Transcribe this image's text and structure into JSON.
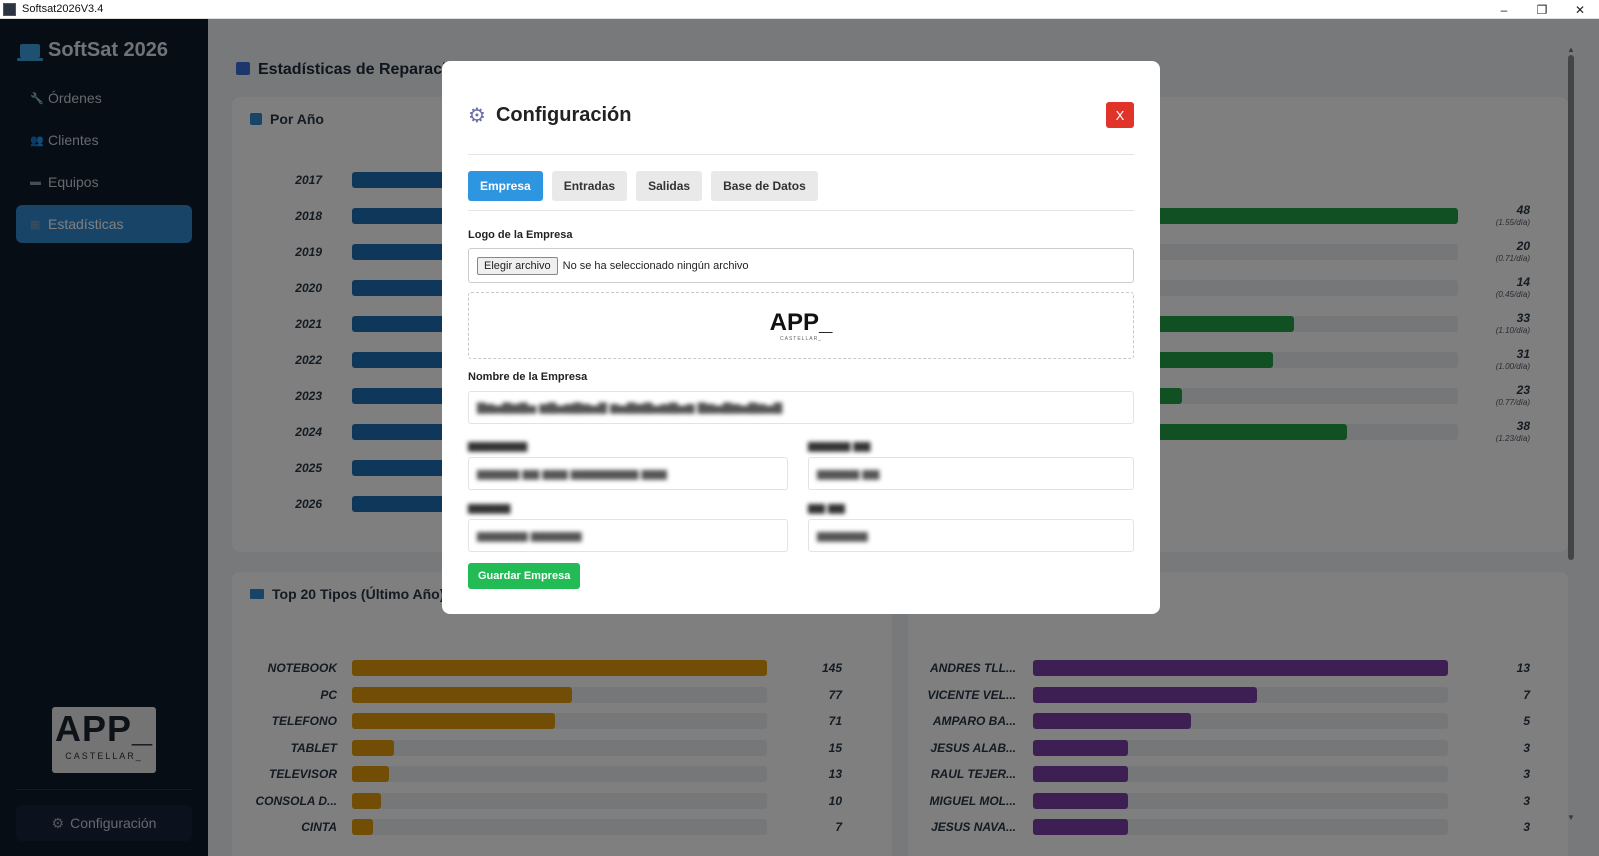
{
  "window": {
    "title": "Softsat2026V3.4",
    "controls": [
      "–",
      "❐",
      "✕"
    ]
  },
  "sidebar": {
    "brand": "SoftSat 2026",
    "items": [
      {
        "label": "Órdenes",
        "icon": "wrench-icon",
        "active": false
      },
      {
        "label": "Clientes",
        "icon": "users-icon",
        "active": false
      },
      {
        "label": "Equipos",
        "icon": "monitor-icon",
        "active": false
      },
      {
        "label": "Estadísticas",
        "icon": "chart-icon",
        "active": true
      }
    ],
    "logo": {
      "big": "APP_",
      "small": "CASTELLAR_"
    },
    "config_label": "Configuración"
  },
  "main": {
    "title": "Estadísticas de Reparacio",
    "year_card": {
      "title": "Por Año",
      "years": [
        "2017",
        "2018",
        "2019",
        "2020",
        "2021",
        "2022",
        "2023",
        "2024",
        "2025",
        "2026"
      ],
      "values": [
        {
          "value": "48",
          "sub": "(1.55/día)",
          "fill": 1.0
        },
        {
          "value": "20",
          "sub": "(0.71/día)",
          "fill": 0.42
        },
        {
          "value": "14",
          "sub": "(0.45/día)",
          "fill": 0.29
        },
        {
          "value": "33",
          "sub": "(1.10/día)",
          "fill": 0.69
        },
        {
          "value": "31",
          "sub": "(1.00/día)",
          "fill": 0.65
        },
        {
          "value": "23",
          "sub": "(0.77/día)",
          "fill": 0.48
        },
        {
          "value": "38",
          "sub": "(1.23/día)",
          "fill": 0.79
        }
      ]
    },
    "types_card": {
      "title": "Top 20 Tipos (Último Año)",
      "rows": [
        {
          "label": "NOTEBOOK",
          "value": "145",
          "fill": 1.0
        },
        {
          "label": "PC",
          "value": "77",
          "fill": 0.53
        },
        {
          "label": "TELEFONO",
          "value": "71",
          "fill": 0.49
        },
        {
          "label": "TABLET",
          "value": "15",
          "fill": 0.1
        },
        {
          "label": "TELEVISOR",
          "value": "13",
          "fill": 0.09
        },
        {
          "label": "CONSOLA D...",
          "value": "10",
          "fill": 0.07
        },
        {
          "label": "CINTA",
          "value": "7",
          "fill": 0.05
        }
      ]
    },
    "clients_card": {
      "rows": [
        {
          "label": "ANDRES TLL...",
          "value": "13",
          "fill": 1.0
        },
        {
          "label": "VICENTE VEL...",
          "value": "7",
          "fill": 0.54
        },
        {
          "label": "AMPARO BA...",
          "value": "5",
          "fill": 0.38
        },
        {
          "label": "JESUS ALAB...",
          "value": "3",
          "fill": 0.23
        },
        {
          "label": "RAUL TEJER...",
          "value": "3",
          "fill": 0.23
        },
        {
          "label": "MIGUEL MOL...",
          "value": "3",
          "fill": 0.23
        },
        {
          "label": "JESUS NAVA...",
          "value": "3",
          "fill": 0.23
        }
      ]
    }
  },
  "modal": {
    "title": "Configuración",
    "close_label": "X",
    "tabs": [
      {
        "label": "Empresa",
        "active": true
      },
      {
        "label": "Entradas",
        "active": false
      },
      {
        "label": "Salidas",
        "active": false
      },
      {
        "label": "Base de Datos",
        "active": false
      }
    ],
    "logo_label": "Logo de la Empresa",
    "file_button": "Elegir archivo",
    "file_status": "No se ha seleccionado ningún archivo",
    "logo_preview": {
      "big": "APP_",
      "small": "CASTELLAR_"
    },
    "name_label": "Nombre de la Empresa",
    "save_button": "Guardar Empresa"
  },
  "colors": {
    "sidebar_bg": "#0f1a2b",
    "accent_blue": "#2e88cf",
    "year_bar": "#1f6fb3",
    "green_bar": "#21a045",
    "orange_bar": "#e39b0c",
    "purple_bar": "#7b3fa8",
    "close_red": "#e0342b",
    "save_green": "#22bb55"
  }
}
